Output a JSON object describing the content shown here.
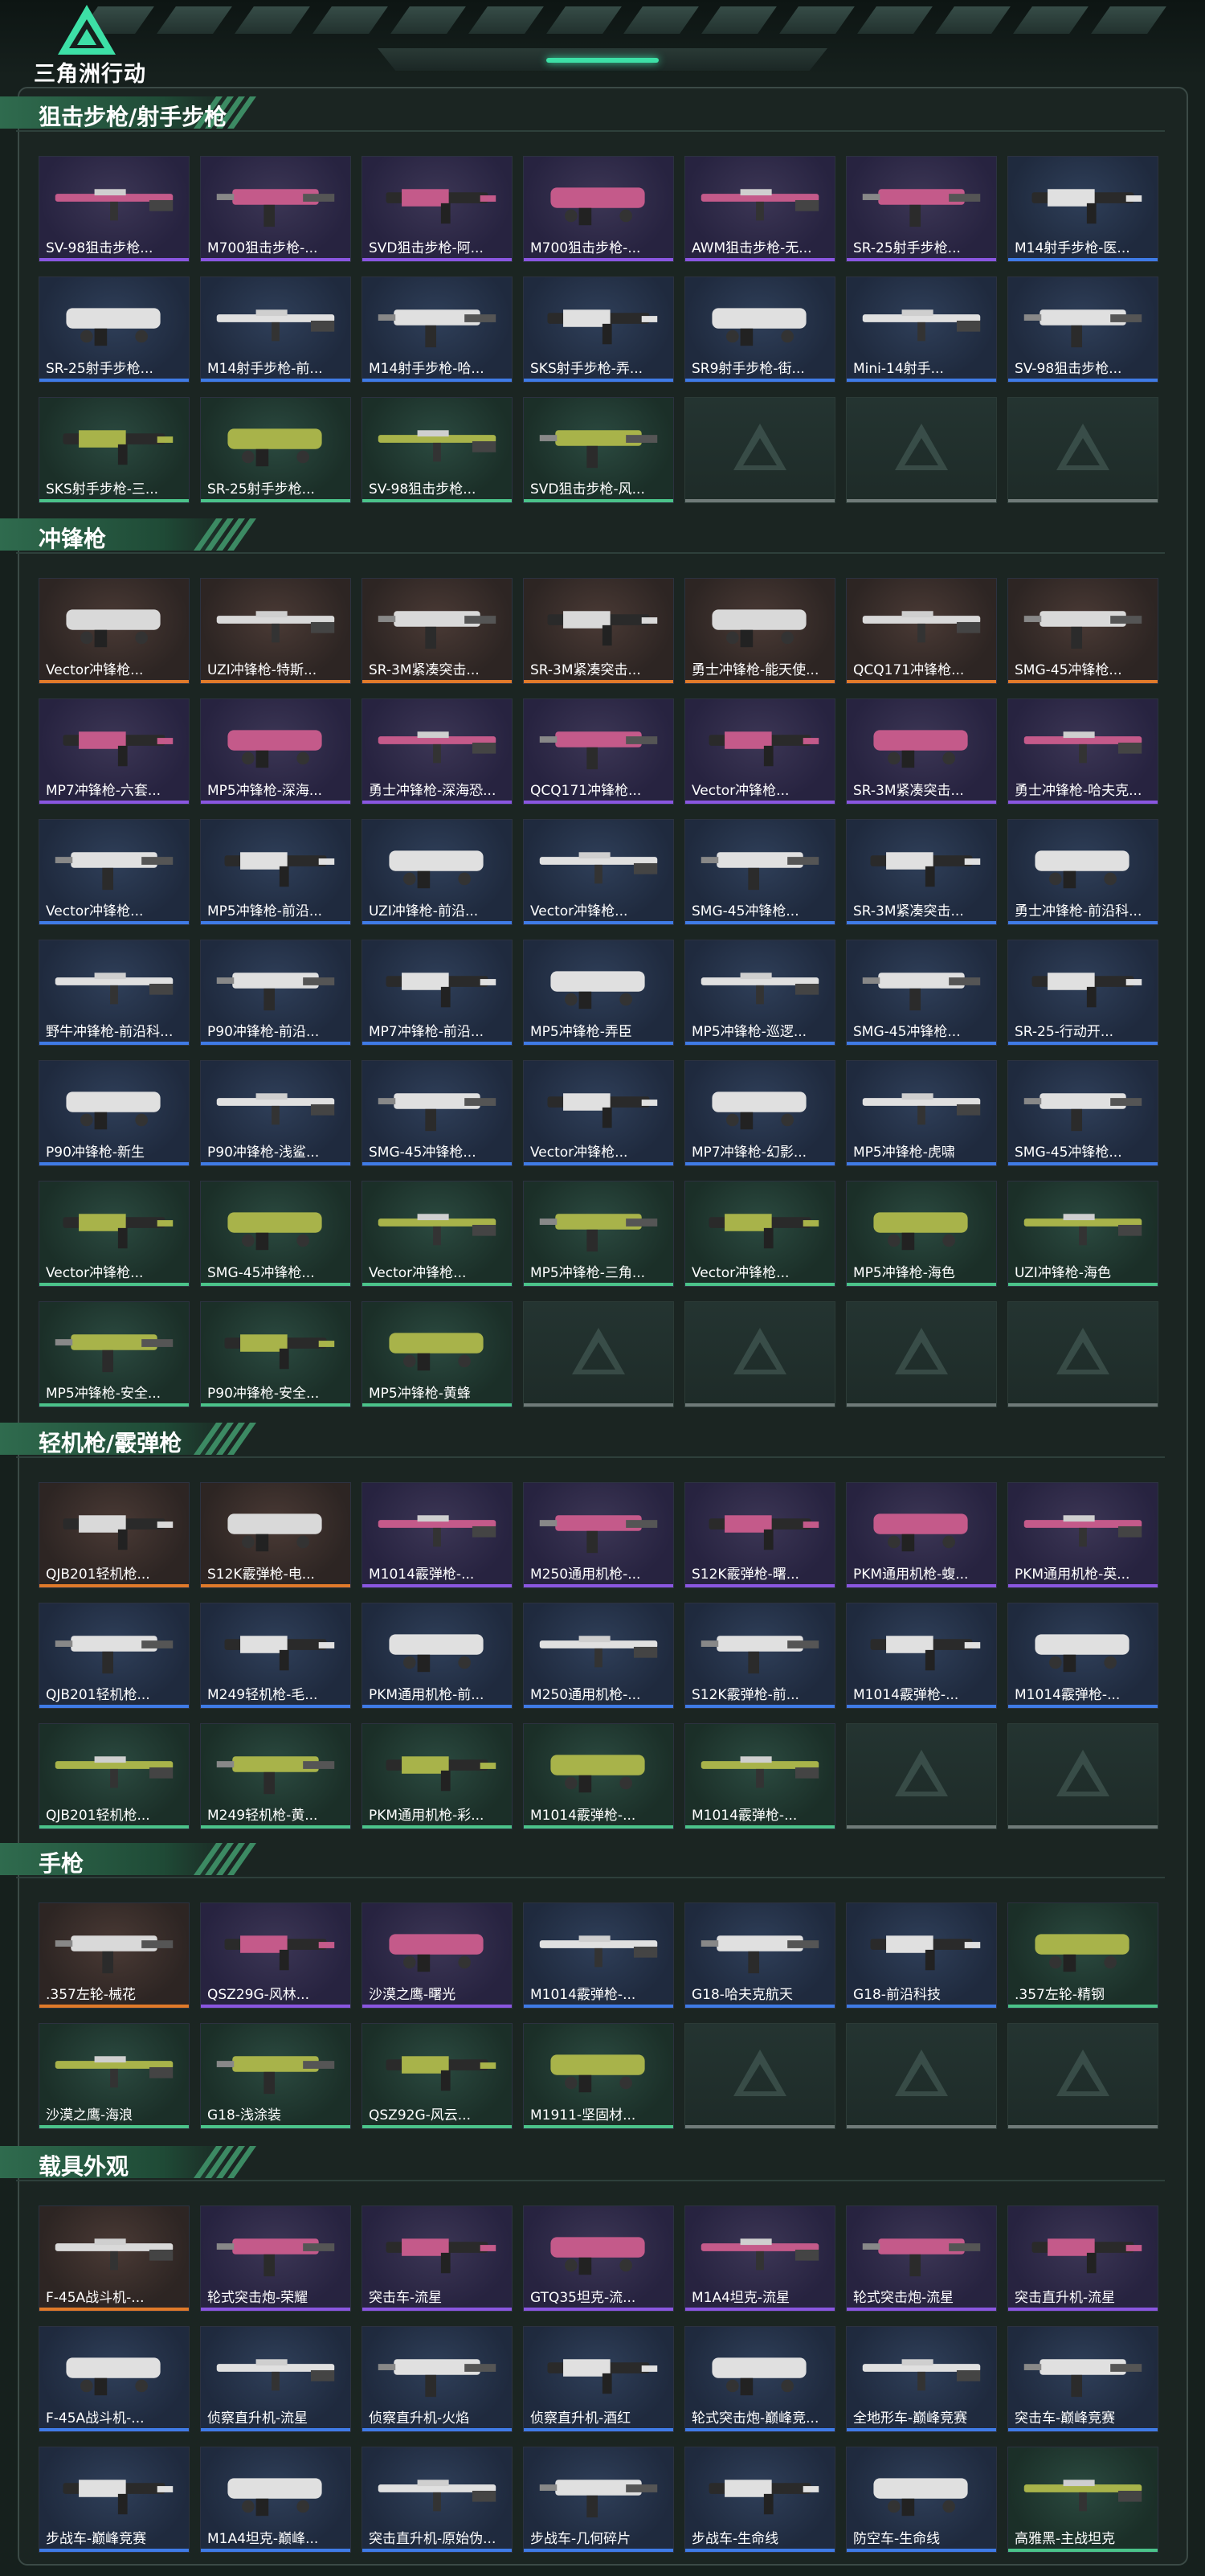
{
  "app": {
    "logo_text": "三角洲行动"
  },
  "colors": {
    "orange": "#e07a2a",
    "purple": "#8a56e0",
    "blue": "#3f7be6",
    "green": "#4bc38a"
  },
  "sections": [
    {
      "title": "狙击步枪/射手步枪",
      "rows": [
        [
          {
            "label": "SV-98狙击步枪...",
            "rarity": "purple"
          },
          {
            "label": "M700狙击步枪-...",
            "rarity": "purple"
          },
          {
            "label": "SVD狙击步枪-阿...",
            "rarity": "purple"
          },
          {
            "label": "M700狙击步枪-...",
            "rarity": "purple"
          },
          {
            "label": "AWM狙击步枪-无...",
            "rarity": "purple"
          },
          {
            "label": "SR-25射手步枪...",
            "rarity": "purple"
          },
          {
            "label": "M14射手步枪-医...",
            "rarity": "blue"
          }
        ],
        [
          {
            "label": "SR-25射手步枪...",
            "rarity": "blue"
          },
          {
            "label": "M14射手步枪-前...",
            "rarity": "blue"
          },
          {
            "label": "M14射手步枪-哈...",
            "rarity": "blue"
          },
          {
            "label": "SKS射手步枪-弄...",
            "rarity": "blue"
          },
          {
            "label": "SR9射手步枪-街...",
            "rarity": "blue"
          },
          {
            "label": "Mini-14射手...",
            "rarity": "blue"
          },
          {
            "label": "SV-98狙击步枪...",
            "rarity": "blue"
          }
        ],
        [
          {
            "label": "SKS射手步枪-三...",
            "rarity": "green"
          },
          {
            "label": "SR-25射手步枪...",
            "rarity": "green"
          },
          {
            "label": "SV-98狙击步枪...",
            "rarity": "green"
          },
          {
            "label": "SVD狙击步枪-风...",
            "rarity": "green"
          },
          null,
          null,
          null
        ]
      ]
    },
    {
      "title": "冲锋枪",
      "rows": [
        [
          {
            "label": "Vector冲锋枪...",
            "rarity": "orange"
          },
          {
            "label": "UZI冲锋枪-特斯...",
            "rarity": "orange"
          },
          {
            "label": "SR-3M紧凑突击...",
            "rarity": "orange"
          },
          {
            "label": "SR-3M紧凑突击...",
            "rarity": "orange"
          },
          {
            "label": "勇士冲锋枪-能天使...",
            "rarity": "orange"
          },
          {
            "label": "QCQ171冲锋枪...",
            "rarity": "orange"
          },
          {
            "label": "SMG-45冲锋枪...",
            "rarity": "orange"
          }
        ],
        [
          {
            "label": "MP7冲锋枪-六套...",
            "rarity": "purple"
          },
          {
            "label": "MP5冲锋枪-深海...",
            "rarity": "purple"
          },
          {
            "label": "勇士冲锋枪-深海恐...",
            "rarity": "purple"
          },
          {
            "label": "QCQ171冲锋枪...",
            "rarity": "purple"
          },
          {
            "label": "Vector冲锋枪...",
            "rarity": "purple"
          },
          {
            "label": "SR-3M紧凑突击...",
            "rarity": "purple"
          },
          {
            "label": "勇士冲锋枪-哈夫克...",
            "rarity": "purple"
          }
        ],
        [
          {
            "label": "Vector冲锋枪...",
            "rarity": "blue"
          },
          {
            "label": "MP5冲锋枪-前沿...",
            "rarity": "blue"
          },
          {
            "label": "UZI冲锋枪-前沿...",
            "rarity": "blue"
          },
          {
            "label": "Vector冲锋枪...",
            "rarity": "blue"
          },
          {
            "label": "SMG-45冲锋枪...",
            "rarity": "blue"
          },
          {
            "label": "SR-3M紧凑突击...",
            "rarity": "blue"
          },
          {
            "label": "勇士冲锋枪-前沿科...",
            "rarity": "blue"
          }
        ],
        [
          {
            "label": "野牛冲锋枪-前沿科...",
            "rarity": "blue"
          },
          {
            "label": "P90冲锋枪-前沿...",
            "rarity": "blue"
          },
          {
            "label": "MP7冲锋枪-前沿...",
            "rarity": "blue"
          },
          {
            "label": "MP5冲锋枪-弄臣",
            "rarity": "blue"
          },
          {
            "label": "MP5冲锋枪-巡逻...",
            "rarity": "blue"
          },
          {
            "label": "SMG-45冲锋枪...",
            "rarity": "blue"
          },
          {
            "label": "SR-25-行动开...",
            "rarity": "blue"
          }
        ],
        [
          {
            "label": "P90冲锋枪-新生",
            "rarity": "blue"
          },
          {
            "label": "P90冲锋枪-浅鲨...",
            "rarity": "blue"
          },
          {
            "label": "SMG-45冲锋枪...",
            "rarity": "blue"
          },
          {
            "label": "Vector冲锋枪...",
            "rarity": "blue"
          },
          {
            "label": "MP7冲锋枪-幻影...",
            "rarity": "blue"
          },
          {
            "label": "MP5冲锋枪-虎啸",
            "rarity": "blue"
          },
          {
            "label": "SMG-45冲锋枪...",
            "rarity": "blue"
          }
        ],
        [
          {
            "label": "Vector冲锋枪...",
            "rarity": "green"
          },
          {
            "label": "SMG-45冲锋枪...",
            "rarity": "green"
          },
          {
            "label": "Vector冲锋枪...",
            "rarity": "green"
          },
          {
            "label": "MP5冲锋枪-三角...",
            "rarity": "green"
          },
          {
            "label": "Vector冲锋枪...",
            "rarity": "green"
          },
          {
            "label": "MP5冲锋枪-海色",
            "rarity": "green"
          },
          {
            "label": "UZI冲锋枪-海色",
            "rarity": "green"
          }
        ],
        [
          {
            "label": "MP5冲锋枪-安全...",
            "rarity": "green"
          },
          {
            "label": "P90冲锋枪-安全...",
            "rarity": "green"
          },
          {
            "label": "MP5冲锋枪-黄蜂",
            "rarity": "green"
          },
          null,
          null,
          null,
          null
        ]
      ]
    },
    {
      "title": "轻机枪/霰弹枪",
      "rows": [
        [
          {
            "label": "QJB201轻机枪...",
            "rarity": "orange"
          },
          {
            "label": "S12K霰弹枪-电...",
            "rarity": "orange"
          },
          {
            "label": "M1014霰弹枪-...",
            "rarity": "purple"
          },
          {
            "label": "M250通用机枪-...",
            "rarity": "purple"
          },
          {
            "label": "S12K霰弹枪-曙...",
            "rarity": "purple"
          },
          {
            "label": "PKM通用机枪-蝮...",
            "rarity": "purple"
          },
          {
            "label": "PKM通用机枪-英...",
            "rarity": "purple"
          }
        ],
        [
          {
            "label": "QJB201轻机枪...",
            "rarity": "blue"
          },
          {
            "label": "M249轻机枪-毛...",
            "rarity": "blue"
          },
          {
            "label": "PKM通用机枪-前...",
            "rarity": "blue"
          },
          {
            "label": "M250通用机枪-...",
            "rarity": "blue"
          },
          {
            "label": "S12K霰弹枪-前...",
            "rarity": "blue"
          },
          {
            "label": "M1014霰弹枪-...",
            "rarity": "blue"
          },
          {
            "label": "M1014霰弹枪-...",
            "rarity": "blue"
          }
        ],
        [
          {
            "label": "QJB201轻机枪...",
            "rarity": "green"
          },
          {
            "label": "M249轻机枪-黄...",
            "rarity": "green"
          },
          {
            "label": "PKM通用机枪-彩...",
            "rarity": "green"
          },
          {
            "label": "M1014霰弹枪-...",
            "rarity": "green"
          },
          {
            "label": "M1014霰弹枪-...",
            "rarity": "green"
          },
          null,
          null
        ]
      ]
    },
    {
      "title": "手枪",
      "rows": [
        [
          {
            "label": ".357左轮-械花",
            "rarity": "orange"
          },
          {
            "label": "QSZ29G-风林...",
            "rarity": "purple"
          },
          {
            "label": "沙漠之鹰-曙光",
            "rarity": "purple"
          },
          {
            "label": "M1014霰弹枪-...",
            "rarity": "blue"
          },
          {
            "label": "G18-哈夫克航天",
            "rarity": "blue"
          },
          {
            "label": "G18-前沿科技",
            "rarity": "blue"
          },
          {
            "label": ".357左轮-精钢",
            "rarity": "green"
          }
        ],
        [
          {
            "label": "沙漠之鹰-海浪",
            "rarity": "green"
          },
          {
            "label": "G18-浅涂装",
            "rarity": "green"
          },
          {
            "label": "QSZ92G-风云...",
            "rarity": "green"
          },
          {
            "label": "M1911-坚固材...",
            "rarity": "green"
          },
          null,
          null,
          null
        ]
      ]
    },
    {
      "title": "载具外观",
      "rows": [
        [
          {
            "label": "F-45A战斗机-...",
            "rarity": "orange"
          },
          {
            "label": "轮式突击炮-荣耀",
            "rarity": "purple"
          },
          {
            "label": "突击车-流星",
            "rarity": "purple"
          },
          {
            "label": "GTQ35坦克-流...",
            "rarity": "purple"
          },
          {
            "label": "M1A4坦克-流星",
            "rarity": "purple"
          },
          {
            "label": "轮式突击炮-流星",
            "rarity": "purple"
          },
          {
            "label": "突击直升机-流星",
            "rarity": "purple"
          }
        ],
        [
          {
            "label": "F-45A战斗机-...",
            "rarity": "blue"
          },
          {
            "label": "侦察直升机-流星",
            "rarity": "blue"
          },
          {
            "label": "侦察直升机-火焰",
            "rarity": "blue"
          },
          {
            "label": "侦察直升机-酒红",
            "rarity": "blue"
          },
          {
            "label": "轮式突击炮-巅峰竞...",
            "rarity": "blue"
          },
          {
            "label": "全地形车-巅峰竞赛",
            "rarity": "blue"
          },
          {
            "label": "突击车-巅峰竞赛",
            "rarity": "blue"
          }
        ],
        [
          {
            "label": "步战车-巅峰竞赛",
            "rarity": "blue"
          },
          {
            "label": "M1A4坦克-巅峰...",
            "rarity": "blue"
          },
          {
            "label": "突击直升机-原始伪...",
            "rarity": "blue"
          },
          {
            "label": "步战车-几何碎片",
            "rarity": "blue"
          },
          {
            "label": "步战车-生命线",
            "rarity": "blue"
          },
          {
            "label": "防空车-生命线",
            "rarity": "blue"
          },
          {
            "label": "高雅黑-主战坦克",
            "rarity": "green"
          }
        ]
      ]
    }
  ]
}
